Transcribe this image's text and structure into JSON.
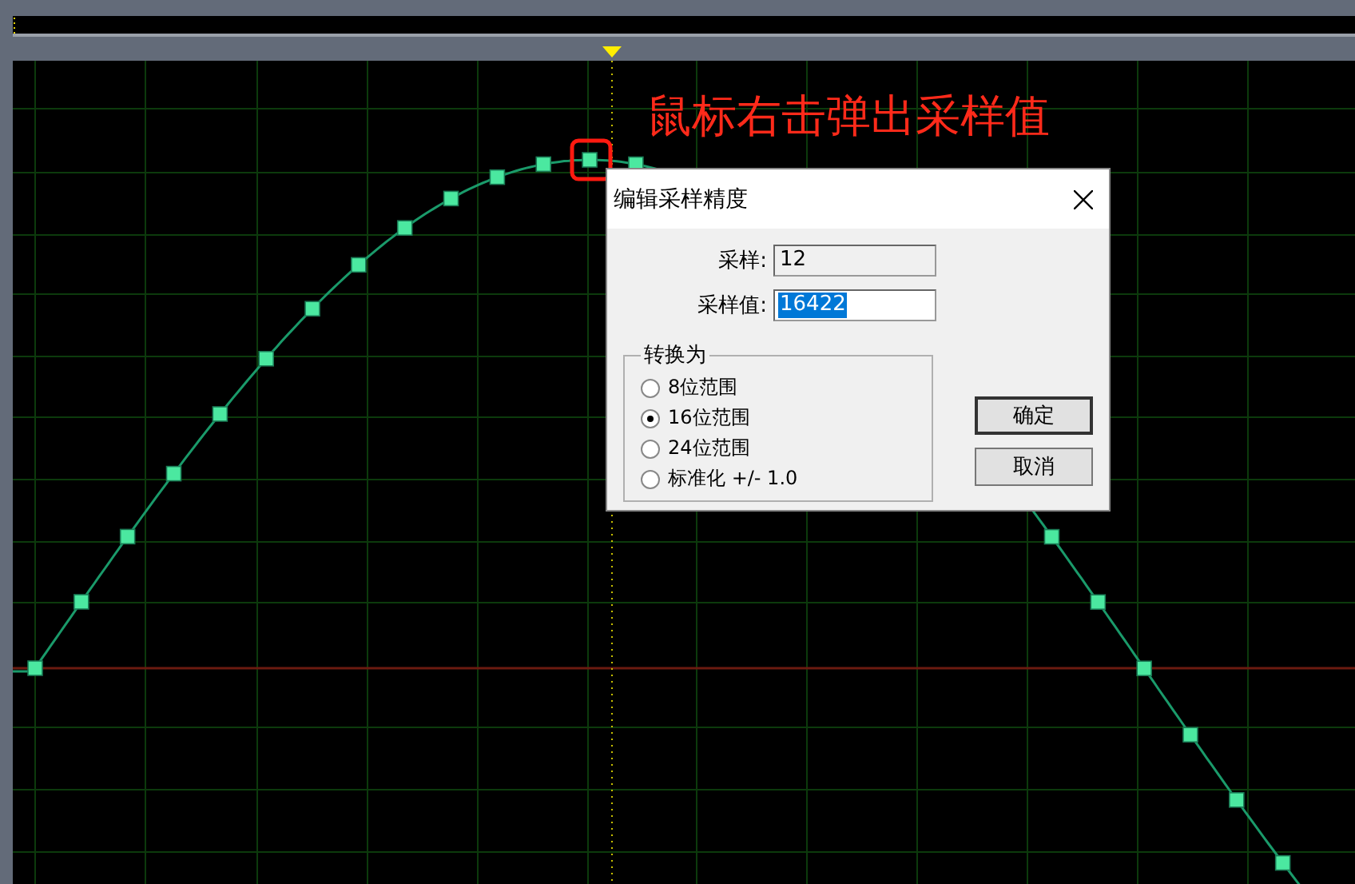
{
  "annotation": "鼠标右击弹出采样值",
  "dialog": {
    "title": "编辑采样精度",
    "fields": [
      {
        "label": "采样:",
        "value": "12",
        "disabled": true,
        "selected": false
      },
      {
        "label": "采样值:",
        "value": "16422",
        "disabled": false,
        "selected": true
      }
    ],
    "group": {
      "title": "转换为",
      "options": [
        {
          "label": "8位范围",
          "selected": false
        },
        {
          "label": "16位范围",
          "selected": true
        },
        {
          "label": "24位范围",
          "selected": false
        },
        {
          "label": "标准化 +/- 1.0",
          "selected": false
        }
      ]
    },
    "buttons": [
      {
        "label": "确定",
        "default": true
      },
      {
        "label": "取消",
        "default": false
      }
    ]
  }
}
